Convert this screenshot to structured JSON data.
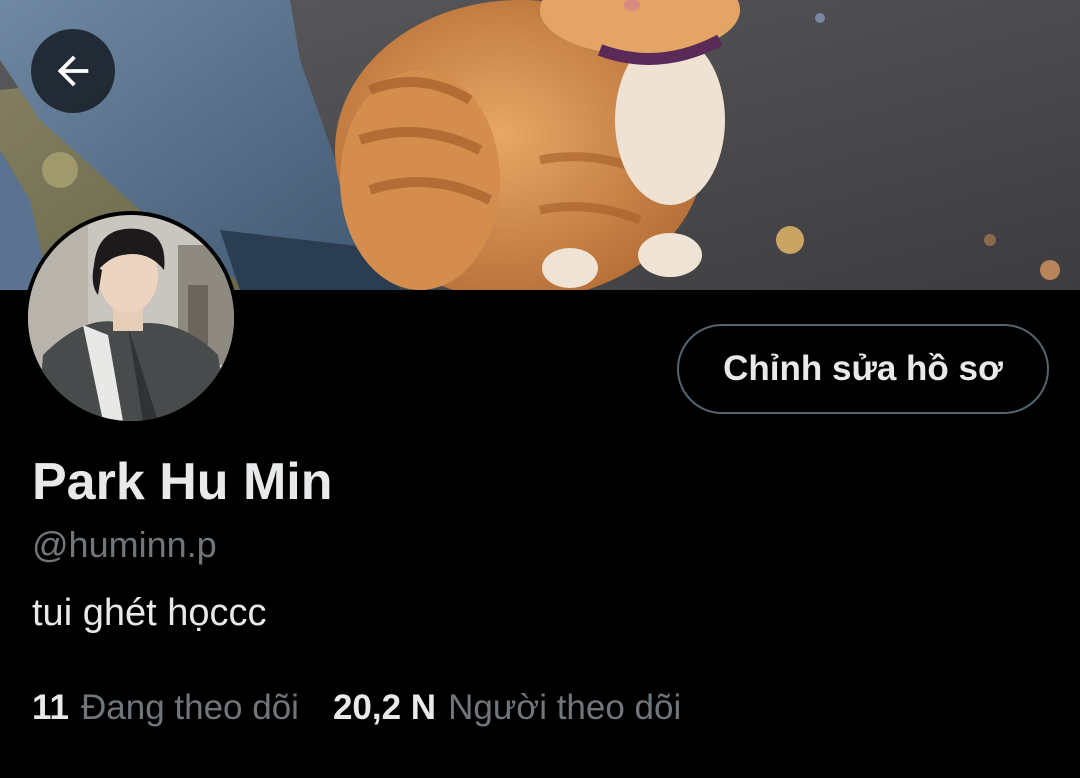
{
  "header": {
    "back_icon": "arrow-left-icon",
    "banner_image": "orange tabby cat sitting on asphalt next to a person's jeans",
    "avatar_image": "young man with dark hair in grey jacket"
  },
  "profile": {
    "edit_button_label": "Chỉnh sửa hồ sơ",
    "display_name": "Park Hu Min",
    "handle": "@huminn.p",
    "bio": "tui ghét họccc"
  },
  "stats": {
    "following_count": "11",
    "following_label": "Đang theo dõi",
    "followers_count": "20,2 N",
    "followers_label": "Người theo dõi"
  },
  "colors": {
    "background": "#000000",
    "primary_text": "#e7e9ea",
    "secondary_text": "#71767b",
    "button_border": "#536471"
  }
}
